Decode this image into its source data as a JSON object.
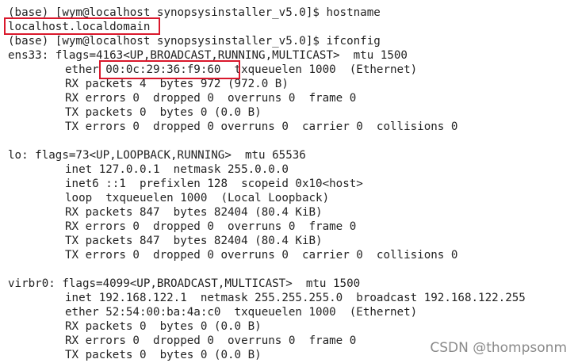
{
  "terminal": {
    "lines": [
      "(base) [wym@localhost synopsysinstaller_v5.0]$ hostname",
      "localhost.localdomain",
      "(base) [wym@localhost synopsysinstaller_v5.0]$ ifconfig",
      "ens33: flags=4163<UP,BROADCAST,RUNNING,MULTICAST>  mtu 1500",
      "ether 00:0c:29:36:f9:60  txqueuelen 1000  (Ethernet)",
      "RX packets 4  bytes 972 (972.0 B)",
      "RX errors 0  dropped 0  overruns 0  frame 0",
      "TX packets 0  bytes 0 (0.0 B)",
      "TX errors 0  dropped 0 overruns 0  carrier 0  collisions 0",
      "",
      "lo: flags=73<UP,LOOPBACK,RUNNING>  mtu 65536",
      "inet 127.0.0.1  netmask 255.0.0.0",
      "inet6 ::1  prefixlen 128  scopeid 0x10<host>",
      "loop  txqueuelen 1000  (Local Loopback)",
      "RX packets 847  bytes 82404 (80.4 KiB)",
      "RX errors 0  dropped 0  overruns 0  frame 0",
      "TX packets 847  bytes 82404 (80.4 KiB)",
      "TX errors 0  dropped 0 overruns 0  carrier 0  collisions 0",
      "",
      "virbr0: flags=4099<UP,BROADCAST,MULTICAST>  mtu 1500",
      "inet 192.168.122.1  netmask 255.255.255.0  broadcast 192.168.122.255",
      "ether 52:54:00:ba:4a:c0  txqueuelen 1000  (Ethernet)",
      "RX packets 0  bytes 0 (0.0 B)",
      "RX errors 0  dropped 0  overruns 0  frame 0",
      "TX packets 0  bytes 0 (0.0 B)"
    ]
  },
  "highlights": [
    {
      "name": "hostname-output-highlight",
      "color": "#d9182c"
    },
    {
      "name": "mac-address-highlight",
      "color": "#d9182c"
    }
  ],
  "watermark": "CSDN @thompsonm"
}
